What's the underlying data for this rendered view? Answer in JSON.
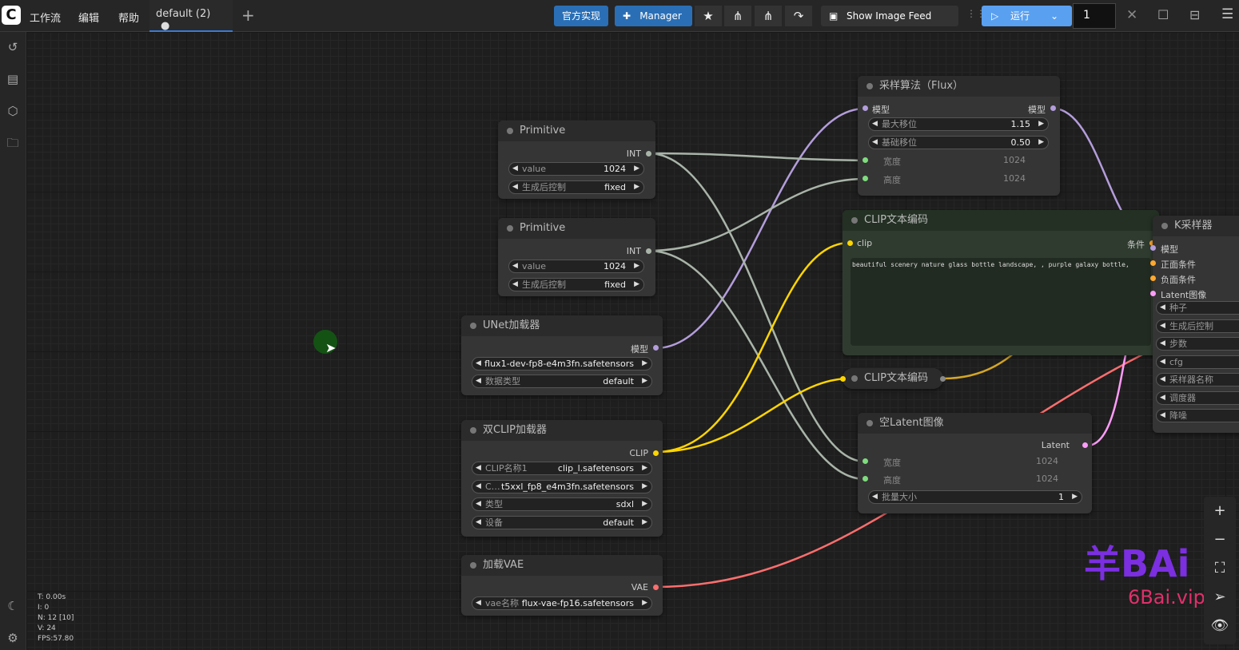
{
  "topbar": {
    "menus": [
      "工作流",
      "编辑",
      "帮助"
    ],
    "tab": "default (2)",
    "tab_dot": "●",
    "official": "官方实现",
    "manager": "Manager",
    "image_feed": "Show Image Feed",
    "run": "运行",
    "queue_count": "1"
  },
  "stats": {
    "t": "T: 0.00s",
    "i": "I: 0",
    "n": "N: 12 [10]",
    "v": "V: 24",
    "fps": "FPS:57.80"
  },
  "nodes": {
    "prim1": {
      "title": "Primitive",
      "out": "INT",
      "w1l": "value",
      "w1v": "1024",
      "w2l": "生成后控制",
      "w2v": "fixed"
    },
    "prim2": {
      "title": "Primitive",
      "out": "INT",
      "w1l": "value",
      "w1v": "1024",
      "w2l": "生成后控制",
      "w2v": "fixed"
    },
    "unet": {
      "title": "UNet加载器",
      "out": "模型",
      "w1v": "flux1-dev-fp8-e4m3fn.safetensors",
      "w2l": "数据类型",
      "w2v": "default"
    },
    "dclip": {
      "title": "双CLIP加载器",
      "out": "CLIP",
      "w1l": "CLIP名称1",
      "w1v": "clip_l.safetensors",
      "w2l": "C…",
      "w2v": "t5xxl_fp8_e4m3fn.safetensors",
      "w3l": "类型",
      "w3v": "sdxl",
      "w4l": "设备",
      "w4v": "default"
    },
    "vae": {
      "title": "加载VAE",
      "out": "VAE",
      "w1l": "vae名称",
      "w1v": "flux-vae-fp16.safetensors"
    },
    "flux": {
      "title": "采样算法（Flux）",
      "in": "模型",
      "out": "模型",
      "w1l": "最大移位",
      "w1v": "1.15",
      "w2l": "基础移位",
      "w2v": "0.50",
      "i2": "宽度",
      "i2v": "1024",
      "i3": "高度",
      "i3v": "1024"
    },
    "clip1": {
      "title": "CLIP文本编码",
      "in": "clip",
      "out": "条件",
      "text": "beautiful scenery nature glass bottle landscape, , purple galaxy bottle,"
    },
    "clip2": {
      "title": "CLIP文本编码"
    },
    "latent": {
      "title": "空Latent图像",
      "out": "Latent",
      "i1": "宽度",
      "i1v": "1024",
      "i2": "高度",
      "i2v": "1024",
      "w1l": "批量大小",
      "w1v": "1"
    },
    "ks": {
      "title": "K采样器",
      "in": [
        "模型",
        "正面条件",
        "负面条件",
        "Latent图像"
      ],
      "w": [
        "种子",
        "生成后控制",
        "步数",
        "cfg",
        "采样器名称",
        "调度器",
        "降噪"
      ]
    }
  },
  "watermark": {
    "big": "羊BAi",
    "small": "6Bai.vip"
  },
  "colors": {
    "accent": "#3a7bd5",
    "clip": "#ffd500",
    "model": "#b39ddb",
    "vae": "#ff6e6e",
    "int": "#a9b4a9",
    "latent": "#ff9cf9"
  }
}
